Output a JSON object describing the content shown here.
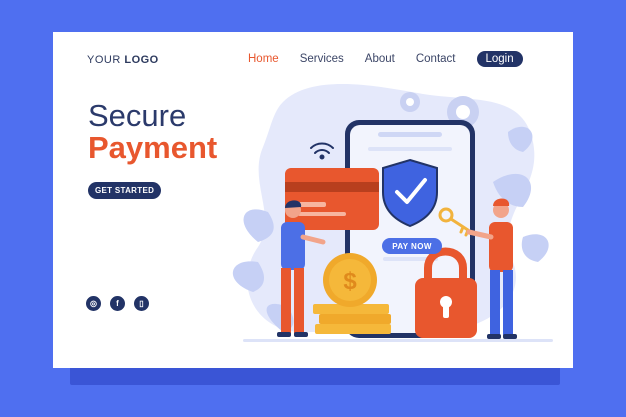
{
  "brand": {
    "logo_prefix": "YOUR",
    "logo_main": "LOGO"
  },
  "nav": {
    "items": [
      {
        "label": "Home",
        "active": true
      },
      {
        "label": "Services",
        "active": false
      },
      {
        "label": "About",
        "active": false
      },
      {
        "label": "Contact",
        "active": false
      }
    ],
    "login_label": "Login"
  },
  "hero": {
    "title_line1": "Secure",
    "title_line2": "Payment",
    "cta_label": "GET STARTED"
  },
  "illustration": {
    "pay_button_label": "PAY NOW",
    "icons": [
      "credit-card-icon",
      "shield-check-icon",
      "padlock-icon",
      "key-icon",
      "dollar-coin-icon",
      "wifi-icon",
      "gear-icon"
    ]
  },
  "social": {
    "icons": [
      "instagram-icon",
      "facebook-icon",
      "phone-icon"
    ]
  },
  "colors": {
    "background": "#4f6ff0",
    "accent": "#e8572e",
    "navy": "#223366",
    "card": "#ffffff"
  }
}
